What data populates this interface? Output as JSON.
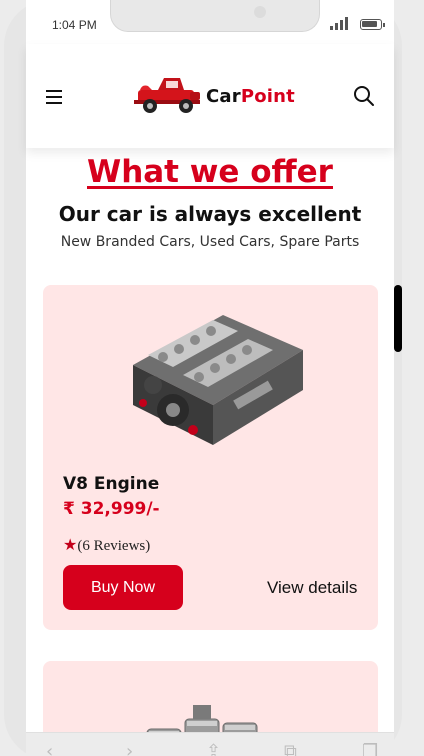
{
  "status_bar": {
    "time": "1:04 PM"
  },
  "header": {
    "brand_part1": "Car",
    "brand_part2": "Point",
    "menu_icon": "hamburger-icon",
    "search_icon": "search-icon"
  },
  "section": {
    "title": "What we offer",
    "subtitle": "Our car is always excellent",
    "description": "New Branded Cars, Used Cars, Spare Parts"
  },
  "products": [
    {
      "name": "V8 Engine",
      "price": "₹ 32,999/-",
      "rating_text": "(6  Reviews)",
      "buy_label": "Buy Now",
      "details_label": "View details"
    }
  ],
  "colors": {
    "accent": "#d6001c",
    "card_bg": "#ffe6e6",
    "text": "#111111"
  }
}
